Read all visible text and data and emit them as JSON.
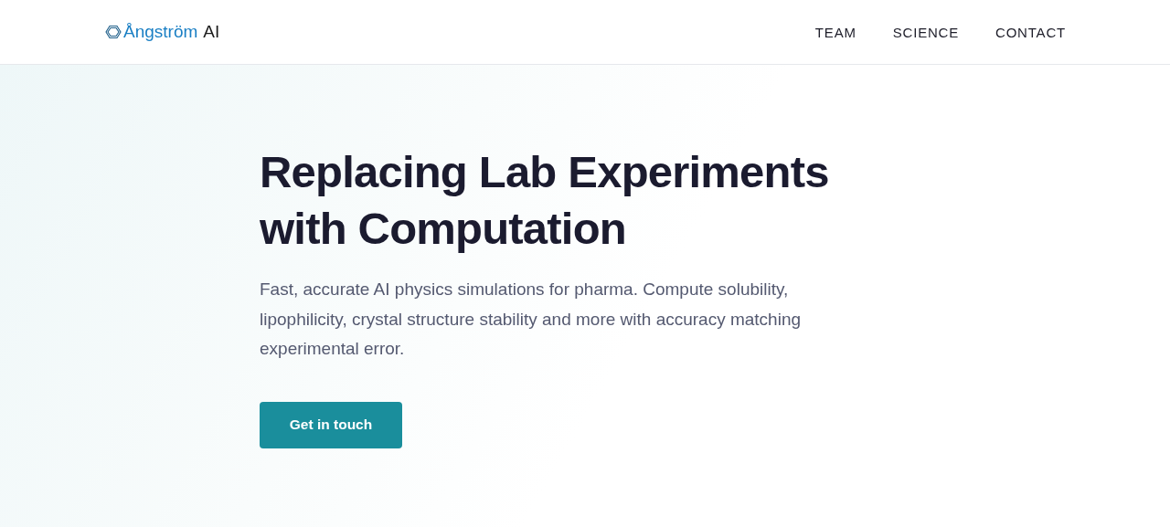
{
  "header": {
    "logo": {
      "brand": "Ångström",
      "suffix": "AI"
    },
    "nav": [
      {
        "label": "TEAM"
      },
      {
        "label": "SCIENCE"
      },
      {
        "label": "CONTACT"
      }
    ]
  },
  "hero": {
    "title_lines": [
      "Replacing Lab Experiments",
      "with Computation"
    ],
    "description": "Fast, accurate AI physics simulations for pharma. Compute solubility, lipophilicity, crystal structure stability and more with accuracy matching experimental error.",
    "button": "Get in touch"
  }
}
